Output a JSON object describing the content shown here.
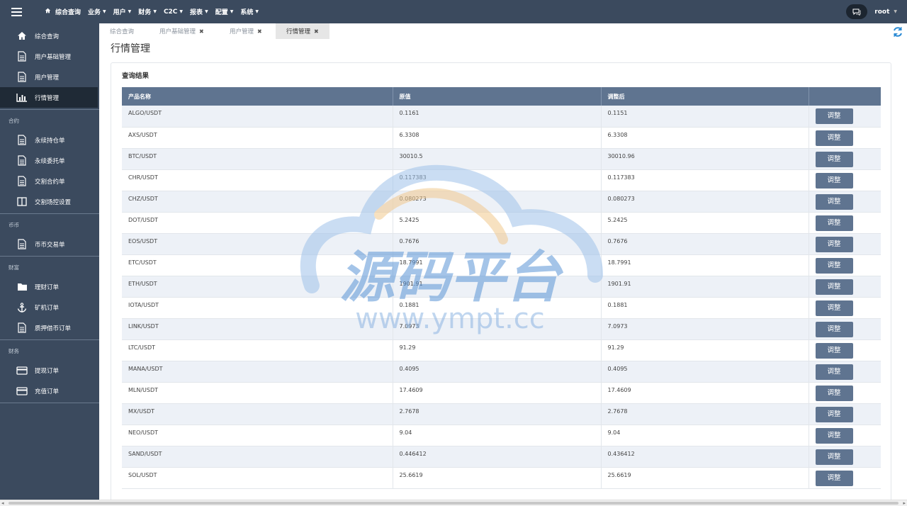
{
  "topnav": {
    "items": [
      {
        "label": "综合查询",
        "caret": false
      },
      {
        "label": "业务",
        "caret": true
      },
      {
        "label": "用户",
        "caret": true
      },
      {
        "label": "财务",
        "caret": true
      },
      {
        "label": "C2C",
        "caret": true
      },
      {
        "label": "报表",
        "caret": true
      },
      {
        "label": "配置",
        "caret": true
      },
      {
        "label": "系统",
        "caret": true
      }
    ],
    "user": "root"
  },
  "sidebar": {
    "group1": [
      {
        "label": "综合查询",
        "icon": "home-icon"
      },
      {
        "label": "用户基础管理",
        "icon": "document-icon"
      },
      {
        "label": "用户管理",
        "icon": "document-icon"
      },
      {
        "label": "行情管理",
        "icon": "bar-chart-icon"
      }
    ],
    "section_contract": "合约",
    "group2": [
      {
        "label": "永续持仓单",
        "icon": "document-icon"
      },
      {
        "label": "永续委托单",
        "icon": "document-icon"
      },
      {
        "label": "交割合约单",
        "icon": "document-icon"
      },
      {
        "label": "交割场控设置",
        "icon": "columns-icon"
      }
    ],
    "section_coin": "币币",
    "group3": [
      {
        "label": "币币交易单",
        "icon": "document-icon"
      }
    ],
    "section_wealth": "财富",
    "group4": [
      {
        "label": "理财订单",
        "icon": "folder-icon"
      },
      {
        "label": "矿机订单",
        "icon": "anchor-icon"
      },
      {
        "label": "质押借币订单",
        "icon": "document-icon"
      }
    ],
    "section_finance": "财务",
    "group5": [
      {
        "label": "提现订单",
        "icon": "card-icon"
      },
      {
        "label": "充值订单",
        "icon": "card-icon"
      }
    ]
  },
  "tabs": [
    {
      "label": "综合查询",
      "closable": false
    },
    {
      "label": "用户基础管理",
      "closable": true
    },
    {
      "label": "用户管理",
      "closable": true
    },
    {
      "label": "行情管理",
      "closable": true,
      "active": true
    }
  ],
  "page_title": "行情管理",
  "panel_title": "查询结果",
  "table": {
    "headers": [
      "产品名称",
      "原值",
      "调整后",
      ""
    ],
    "button_label": "调整",
    "rows": [
      [
        "ALGO/USDT",
        "0.1161",
        "0.1151"
      ],
      [
        "AXS/USDT",
        "6.3308",
        "6.3308"
      ],
      [
        "BTC/USDT",
        "30010.5",
        "30010.96"
      ],
      [
        "CHR/USDT",
        "0.117383",
        "0.117383"
      ],
      [
        "CHZ/USDT",
        "0.080273",
        "0.080273"
      ],
      [
        "DOT/USDT",
        "5.2425",
        "5.2425"
      ],
      [
        "EOS/USDT",
        "0.7676",
        "0.7676"
      ],
      [
        "ETC/USDT",
        "18.7991",
        "18.7991"
      ],
      [
        "ETH/USDT",
        "1901.91",
        "1901.91"
      ],
      [
        "IOTA/USDT",
        "0.1881",
        "0.1881"
      ],
      [
        "LINK/USDT",
        "7.0973",
        "7.0973"
      ],
      [
        "LTC/USDT",
        "91.29",
        "91.29"
      ],
      [
        "MANA/USDT",
        "0.4095",
        "0.4095"
      ],
      [
        "MLN/USDT",
        "17.4609",
        "17.4609"
      ],
      [
        "MX/USDT",
        "2.7678",
        "2.7678"
      ],
      [
        "NEO/USDT",
        "9.04",
        "9.04"
      ],
      [
        "SAND/USDT",
        "0.446412",
        "0.436412"
      ],
      [
        "SOL/USDT",
        "25.6619",
        "25.6619"
      ]
    ]
  },
  "watermark": {
    "title": "源码平台",
    "url": "www.ympt.cc"
  },
  "colors": {
    "nav_bg": "#3b4a5e",
    "header_bg": "#5f7490",
    "accent": "#2a8ad4"
  }
}
